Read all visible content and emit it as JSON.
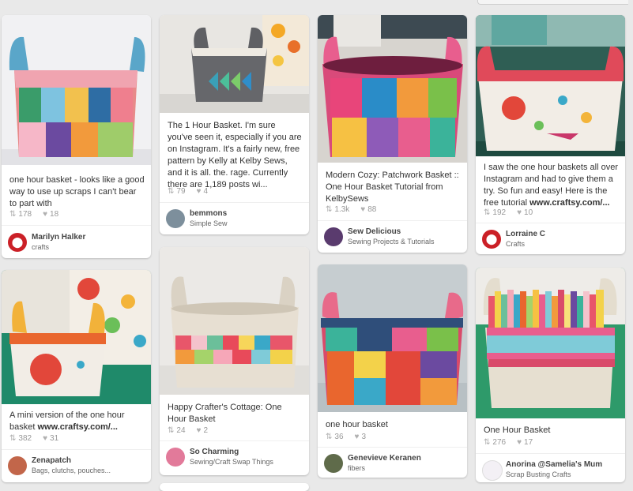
{
  "pins": [
    {
      "description": "one hour basket - looks like a good way to use up scraps I can't bear to part with",
      "repins": "178",
      "likes": "18",
      "user": "Marilyn Halker",
      "board": "crafts",
      "avatar_icon": "pin-icon"
    },
    {
      "description": "The 1 Hour Basket. I'm sure you've seen it, especially if you are on Instagram. It's a fairly new, free pattern by Kelly at Kelby Sews, and it is all. the. rage. Currently there are 1,189 posts wi...",
      "repins": "79",
      "likes": "4",
      "user": "bemmons",
      "board": "Simple Sew",
      "avatar_icon": "user-photo"
    },
    {
      "description": "Modern Cozy: Patchwork Basket :: One Hour Basket Tutorial from KelbySews",
      "repins": "1.3k",
      "likes": "88",
      "user": "Sew Delicious",
      "board": "Sewing Projects & Tutorials",
      "avatar_icon": "user-photo"
    },
    {
      "description_prefix": "I saw the one hour baskets all over Instagram and had to give them a try. So fun and easy! Here is the free tutorial ",
      "description_link": "www.craftsy.com/...",
      "repins": "192",
      "likes": "10",
      "user": "Lorraine C",
      "board": "Crafts",
      "avatar_icon": "pin-icon"
    },
    {
      "description_prefix": "A mini version of the one hour basket ",
      "description_link": "www.craftsy.com/...",
      "repins": "382",
      "likes": "31",
      "user": "Zenapatch",
      "board": "Bags, clutchs, pouches...",
      "avatar_icon": "user-photo"
    },
    {
      "description": "Happy Crafter's Cottage: One Hour Basket",
      "repins": "24",
      "likes": "2",
      "user": "So Charming",
      "board": "Sewing/Craft Swap Things",
      "avatar_icon": "user-photo"
    },
    {
      "description": "one hour basket",
      "repins": "36",
      "likes": "3",
      "user": "Genevieve Keranen",
      "board": "fibers",
      "avatar_icon": "user-photo"
    },
    {
      "description": "One Hour Basket",
      "repins": "276",
      "likes": "17",
      "user": "Anorina @Samelia's Mum",
      "board": "Scrap Busting Crafts",
      "avatar_icon": "user-photo"
    }
  ],
  "icons": {
    "repin": "repin-icon",
    "like": "heart-icon",
    "pin": "pin-icon"
  },
  "colors": {
    "pin_red": "#cb2027",
    "background": "#e9e9e9",
    "card": "#ffffff"
  }
}
